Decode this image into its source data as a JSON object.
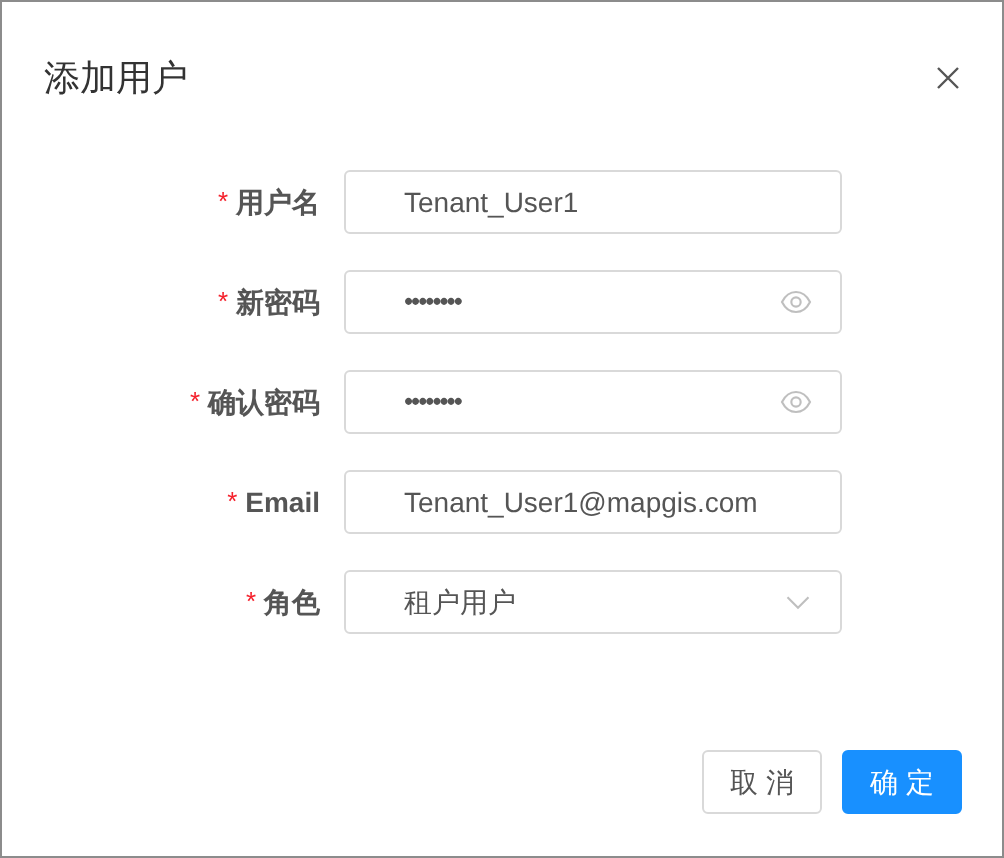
{
  "dialog": {
    "title": "添加用户"
  },
  "fields": [
    {
      "kind": "text",
      "required_mark": "*",
      "label": "用户名",
      "value": "Tenant_User1"
    },
    {
      "kind": "password",
      "required_mark": "*",
      "label": "新密码",
      "value": "••••••••"
    },
    {
      "kind": "password",
      "required_mark": "*",
      "label": "确认密码",
      "value": "••••••••"
    },
    {
      "kind": "text",
      "required_mark": "*",
      "label": "Email",
      "value": "Tenant_User1@mapgis.com"
    },
    {
      "kind": "select",
      "required_mark": "*",
      "label": "角色",
      "value": "租户用户"
    }
  ],
  "buttons": [
    {
      "label": "取 消",
      "kind": "default"
    },
    {
      "label": "确 定",
      "kind": "primary"
    }
  ]
}
